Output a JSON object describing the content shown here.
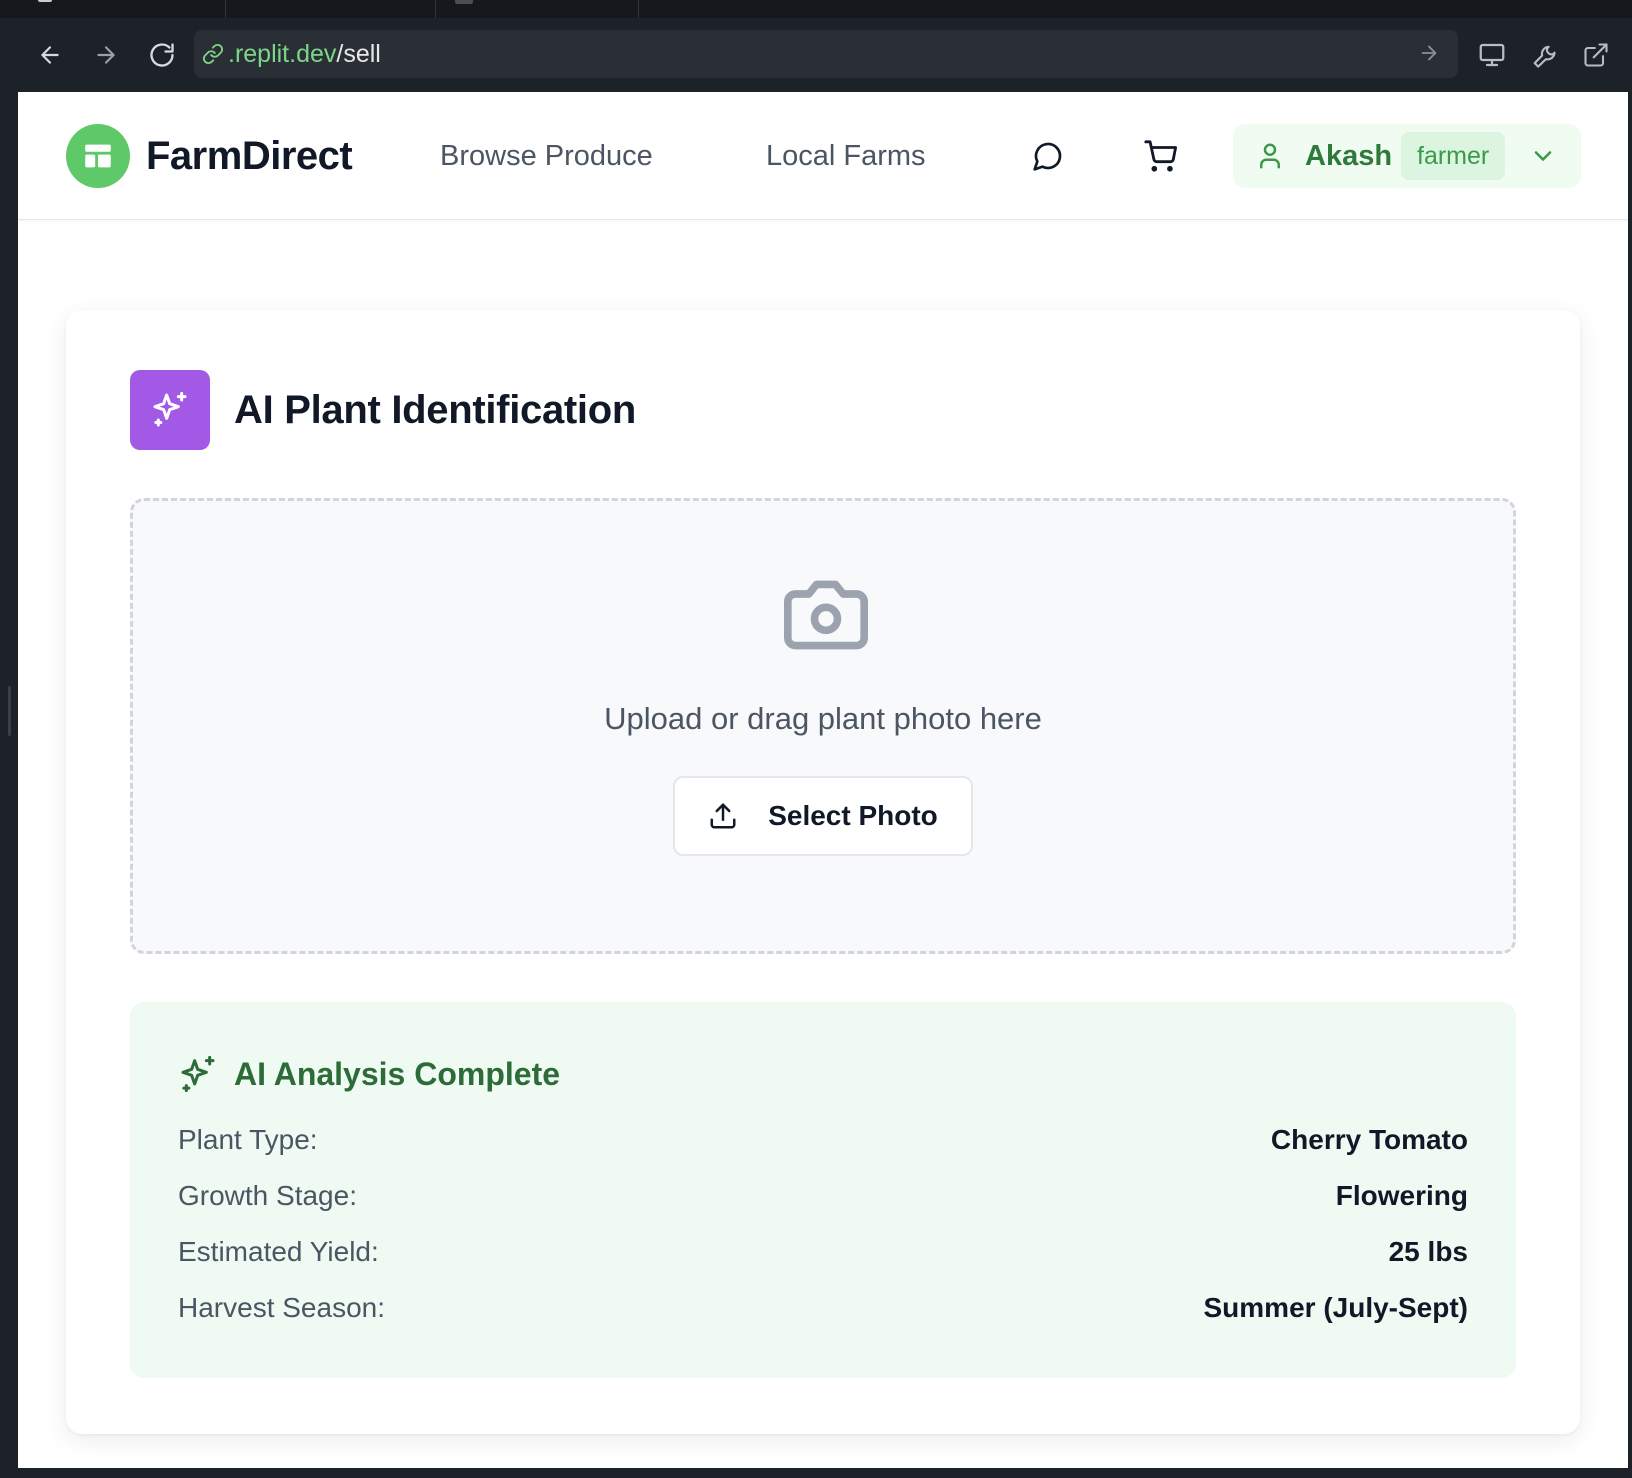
{
  "browser": {
    "url_host": ".replit.dev",
    "url_path": "/sell"
  },
  "nav": {
    "brand": "FarmDirect",
    "links": [
      "Browse Produce",
      "Local Farms"
    ],
    "user": {
      "name": "Akash",
      "role": "farmer"
    }
  },
  "card": {
    "title": "AI Plant Identification",
    "dropzone": {
      "prompt": "Upload or drag plant photo here",
      "button": "Select Photo"
    },
    "analysis": {
      "title": "AI Analysis Complete",
      "rows": [
        {
          "label": "Plant Type:",
          "value": "Cherry Tomato"
        },
        {
          "label": "Growth Stage:",
          "value": "Flowering"
        },
        {
          "label": "Estimated Yield:",
          "value": "25 lbs"
        },
        {
          "label": "Harvest Season:",
          "value": "Summer (July-Sept)"
        }
      ]
    }
  },
  "colors": {
    "brand_green": "#5fc96a",
    "ai_purple": "#a25ae6",
    "analysis_bg": "#effaf2",
    "analysis_title": "#2d6b38"
  },
  "icons": [
    "back-icon",
    "forward-icon",
    "reload-icon",
    "link-icon",
    "go-icon",
    "desktop-icon",
    "wrench-icon",
    "external-link-icon",
    "store-icon",
    "chat-icon",
    "cart-icon",
    "user-icon",
    "chevron-down-icon",
    "sparkles-icon",
    "camera-icon",
    "upload-icon"
  ]
}
